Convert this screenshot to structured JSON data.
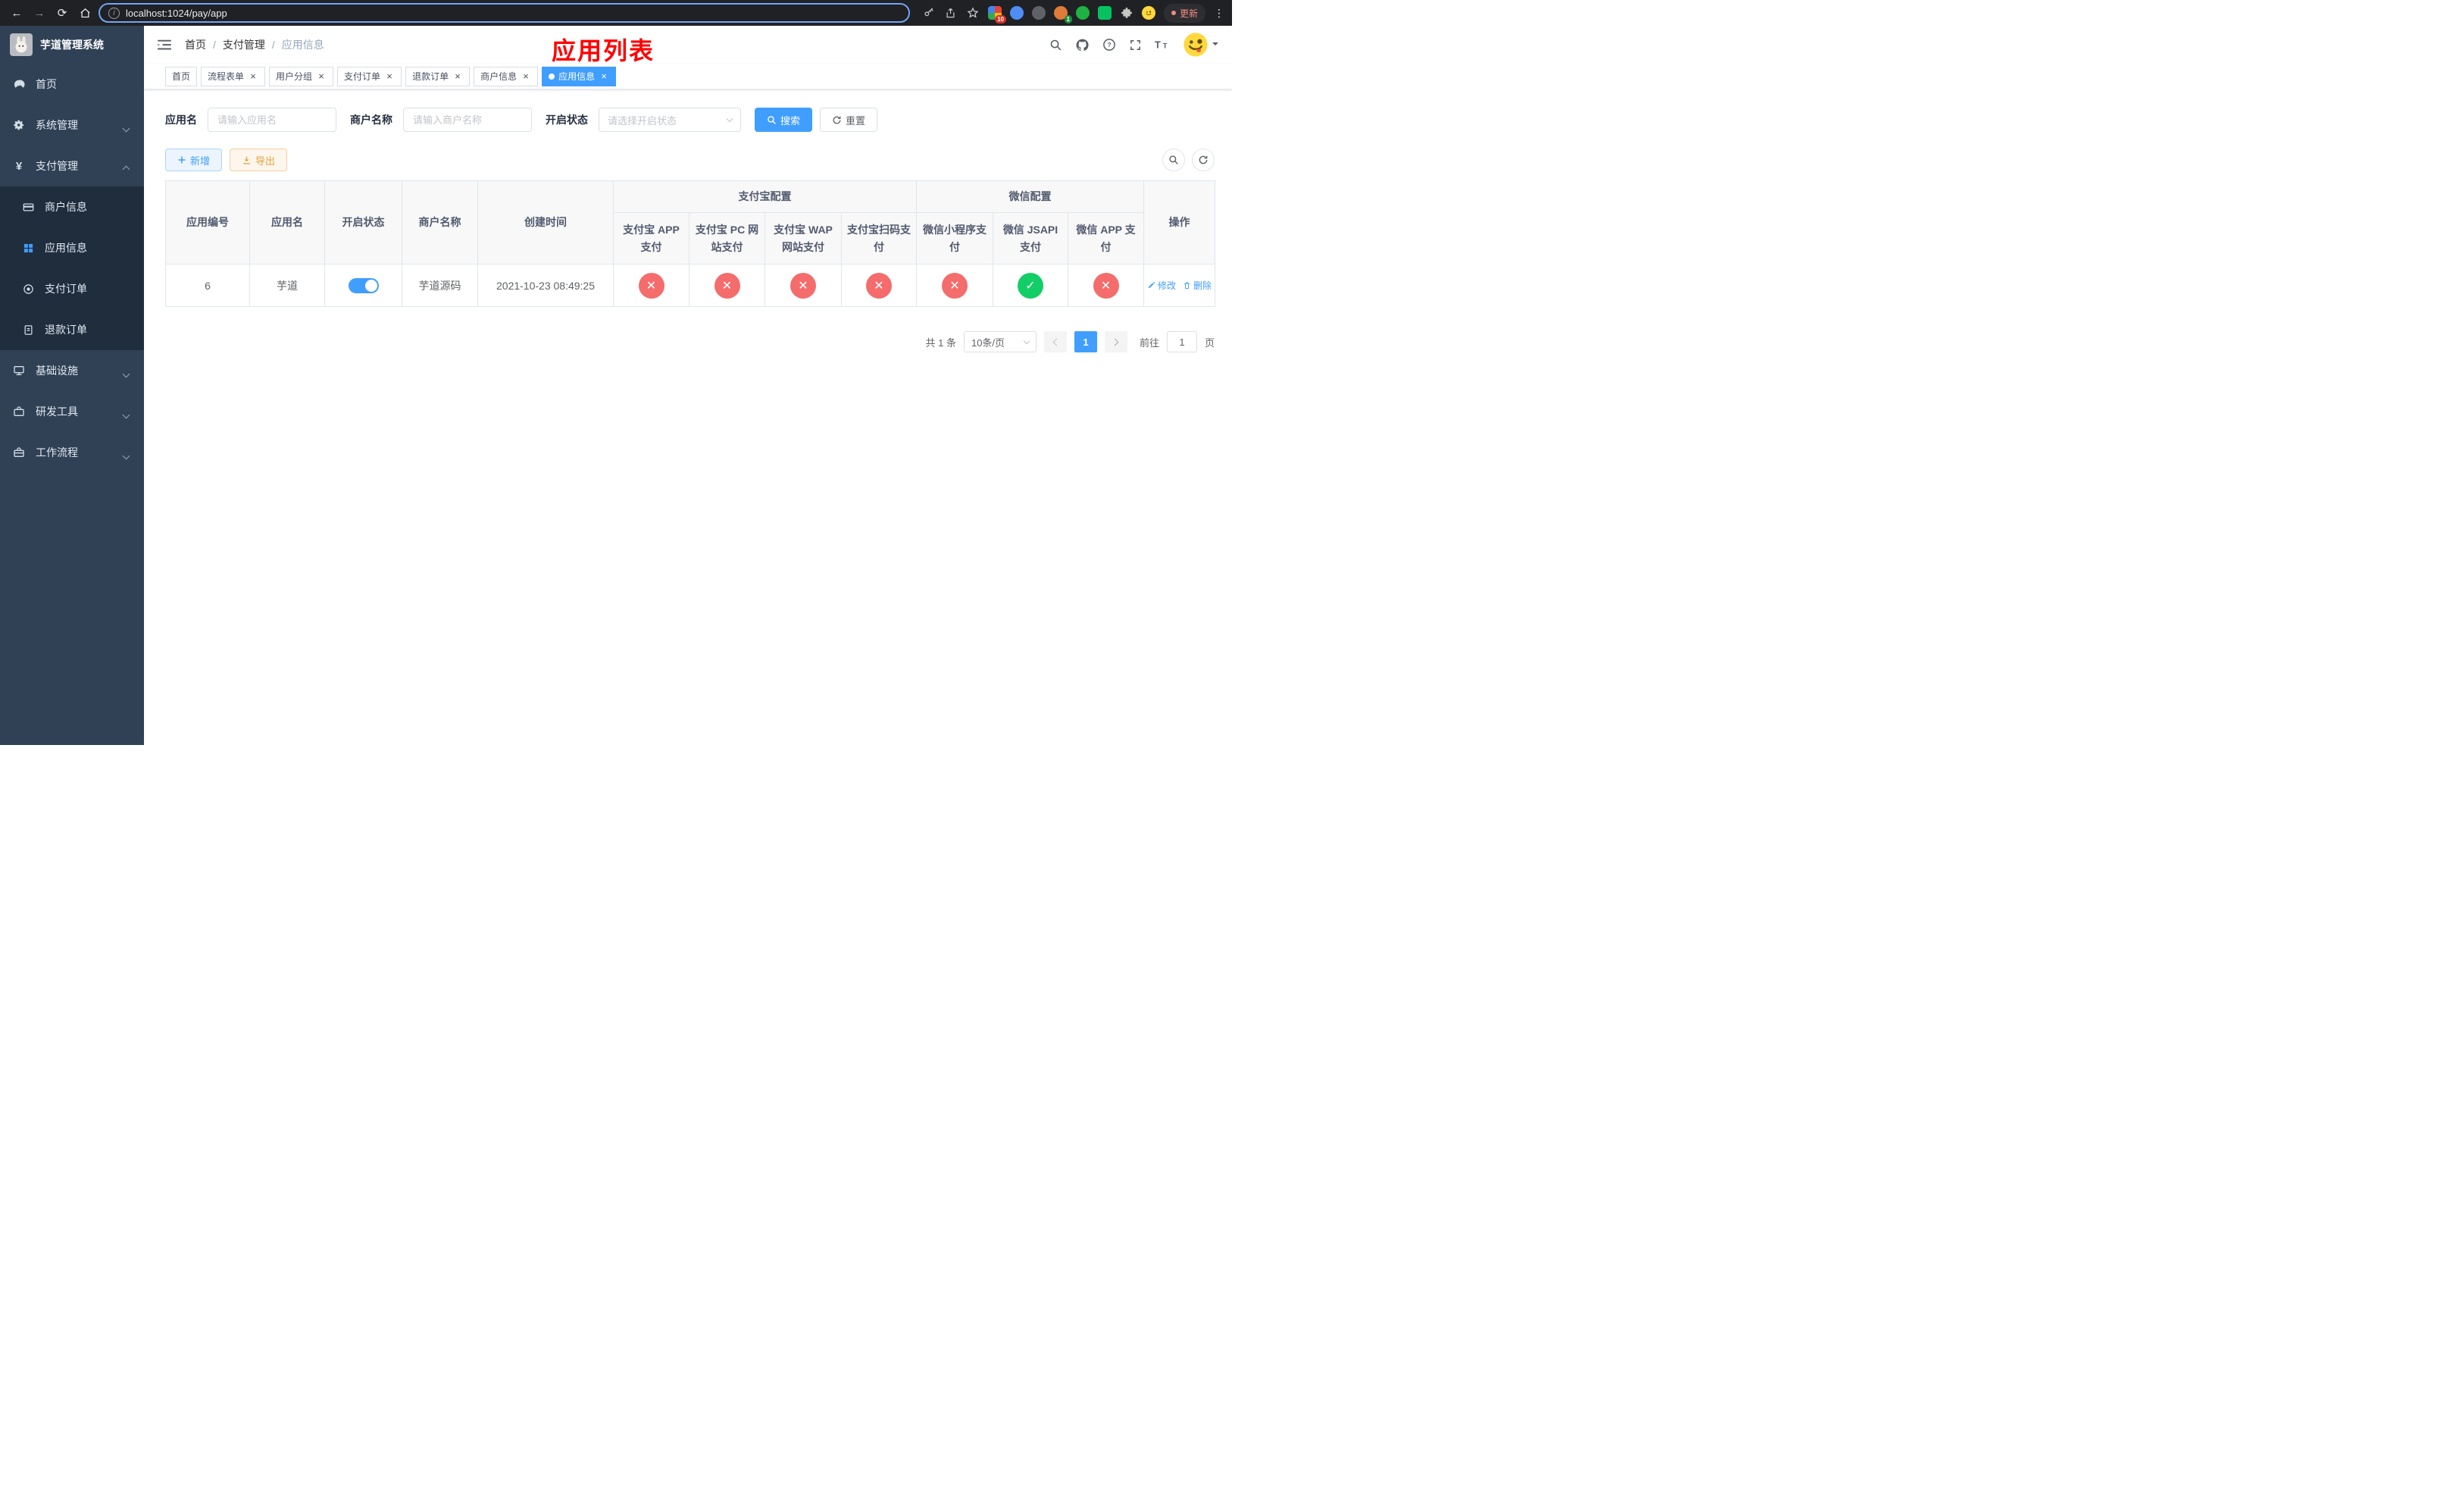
{
  "browser": {
    "url": "localhost:1024/pay/app",
    "update_label": "更新",
    "extension_badge": "10",
    "profile_badge": "1"
  },
  "sidebar": {
    "title": "芋道管理系统",
    "items": {
      "home": "首页",
      "system": "系统管理",
      "payment": "支付管理",
      "merchant": "商户信息",
      "app_info": "应用信息",
      "pay_order": "支付订单",
      "refund_order": "退款订单",
      "infra": "基础设施",
      "dev_tools": "研发工具",
      "workflow": "工作流程"
    }
  },
  "header": {
    "breadcrumb": [
      "首页",
      "支付管理",
      "应用信息"
    ],
    "annotation": "应用列表"
  },
  "tabs": [
    {
      "label": "首页"
    },
    {
      "label": "流程表单"
    },
    {
      "label": "用户分组"
    },
    {
      "label": "支付订单"
    },
    {
      "label": "退款订单"
    },
    {
      "label": "商户信息"
    },
    {
      "label": "应用信息"
    }
  ],
  "tabs_active_index": 6,
  "filter": {
    "app_name_label": "应用名",
    "app_name_placeholder": "请输入应用名",
    "merchant_label": "商户名称",
    "merchant_placeholder": "请输入商户名称",
    "status_label": "开启状态",
    "status_placeholder": "请选择开启状态",
    "search": "搜索",
    "reset": "重置"
  },
  "toolbar": {
    "add": "新增",
    "export": "导出"
  },
  "table": {
    "columns": {
      "app_id": "应用编号",
      "app_name": "应用名",
      "status": "开启状态",
      "merchant_name": "商户名称",
      "created_at": "创建时间",
      "alipay_group": "支付宝配置",
      "wechat_group": "微信配置",
      "actions": "操作",
      "alipay_app": "支付宝 APP 支付",
      "alipay_pc": "支付宝 PC 网站支付",
      "alipay_wap": "支付宝 WAP 网站支付",
      "alipay_qr": "支付宝扫码支付",
      "wx_lite": "微信小程序支付",
      "wx_jsapi": "微信 JSAPI 支付",
      "wx_app": "微信 APP 支付"
    },
    "rows": [
      {
        "app_id": "6",
        "app_name": "芋道",
        "status_on": true,
        "merchant_name": "芋道源码",
        "created_at": "2021-10-23 08:49:25",
        "configs": {
          "alipay_app": false,
          "alipay_pc": false,
          "alipay_wap": false,
          "alipay_qr": false,
          "wx_lite": false,
          "wx_jsapi": true,
          "wx_app": false
        },
        "edit": "修改",
        "delete": "删除"
      }
    ]
  },
  "pagination": {
    "total": "共 1 条",
    "page_size": "10条/页",
    "page": "1",
    "goto": "前往",
    "goto_value": "1",
    "unit": "页"
  },
  "icons": {
    "check": "✓",
    "cross": "✕"
  },
  "colors": {
    "primary": "#409eff",
    "success": "#13ce66",
    "danger": "#f56c6c",
    "warning": "#e6a23c",
    "sidebar_bg": "#304156",
    "submenu_bg": "#1f2d3d",
    "annotation": "#ff0000"
  }
}
